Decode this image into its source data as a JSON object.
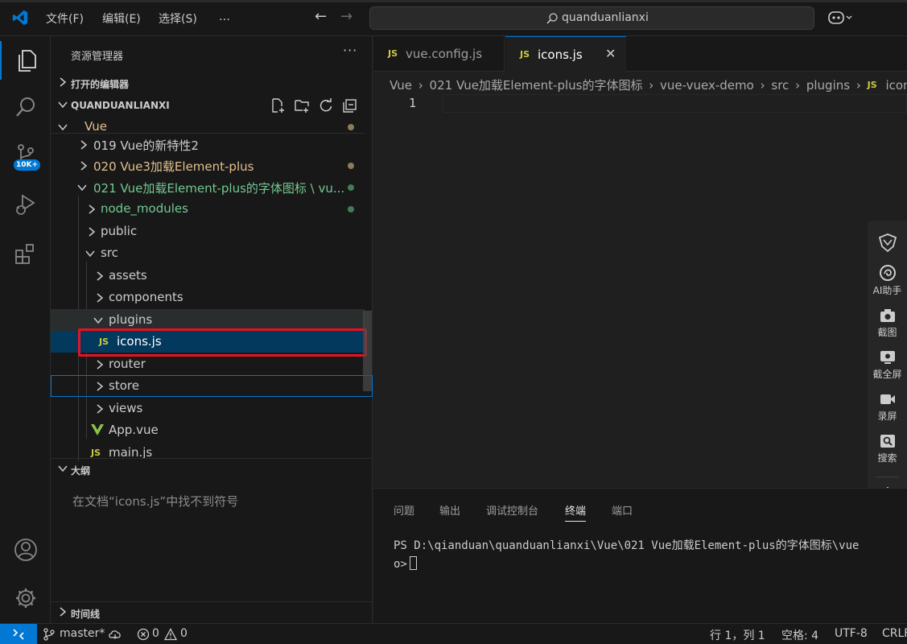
{
  "titlebar": {
    "menus": [
      "文件(F)",
      "编辑(E)",
      "选择(S)",
      "…"
    ],
    "search_text": "quanduanlianxi"
  },
  "sidebar": {
    "title": "资源管理器",
    "more": "···",
    "open_editors": "打开的编辑器",
    "workspace": "QUANDUANLIANXI",
    "tree": [
      {
        "label": "Vue",
        "color": "#e2c08d",
        "dot": "#8c7a5a"
      },
      {
        "label": "019 Vue的新特性2",
        "color": "#cccccc"
      },
      {
        "label": "020 Vue3加载Element-plus",
        "color": "#e2c08d",
        "dot": "#8c7a5a"
      },
      {
        "label": "021 Vue加载Element-plus的字体图标 \\ vu...",
        "color": "#73c991",
        "dot": "#3e7d55"
      },
      {
        "label": "node_modules",
        "color": "#73c991",
        "dot": "#3e7d55"
      },
      {
        "label": "public",
        "color": "#cccccc"
      },
      {
        "label": "src",
        "color": "#cccccc"
      },
      {
        "label": "assets",
        "color": "#cccccc"
      },
      {
        "label": "components",
        "color": "#cccccc"
      },
      {
        "label": "plugins",
        "color": "#cccccc"
      },
      {
        "label": "icons.js",
        "color": "#ffffff"
      },
      {
        "label": "router",
        "color": "#cccccc"
      },
      {
        "label": "store",
        "color": "#cccccc"
      },
      {
        "label": "views",
        "color": "#cccccc"
      },
      {
        "label": "App.vue",
        "color": "#cccccc"
      },
      {
        "label": "main.js",
        "color": "#cccccc"
      }
    ],
    "js_label": "JS",
    "outline_title": "大纲",
    "outline_msg": "在文档“icons.js”中找不到符号",
    "timeline_title": "时间线"
  },
  "editor": {
    "tabs": [
      {
        "label": "vue.config.js"
      },
      {
        "label": "icons.js"
      }
    ],
    "close": "✕",
    "breadcrumb": [
      "Vue",
      "021 Vue加载Element-plus的字体图标",
      "vue-vuex-demo",
      "src",
      "plugins",
      "icons"
    ],
    "line_number": "1"
  },
  "float_tools": {
    "ai": "AI助手",
    "shot": "截图",
    "full": "截全屏",
    "record": "录屏",
    "search": "搜索"
  },
  "panel": {
    "tabs": [
      "问题",
      "输出",
      "调试控制台",
      "终端",
      "端口"
    ],
    "terminal_line1": "PS D:\\qianduan\\quanduanlianxi\\Vue\\021 Vue加载Element-plus的字体图标\\vue",
    "terminal_line2": "o>"
  },
  "status": {
    "branch": "master*",
    "errors": "0",
    "warnings": "0",
    "position": "行 1，列 1",
    "spaces": "空格: 4",
    "encoding": "UTF-8",
    "eol": "CRLF"
  },
  "badges": {
    "extensions": "10K+"
  }
}
